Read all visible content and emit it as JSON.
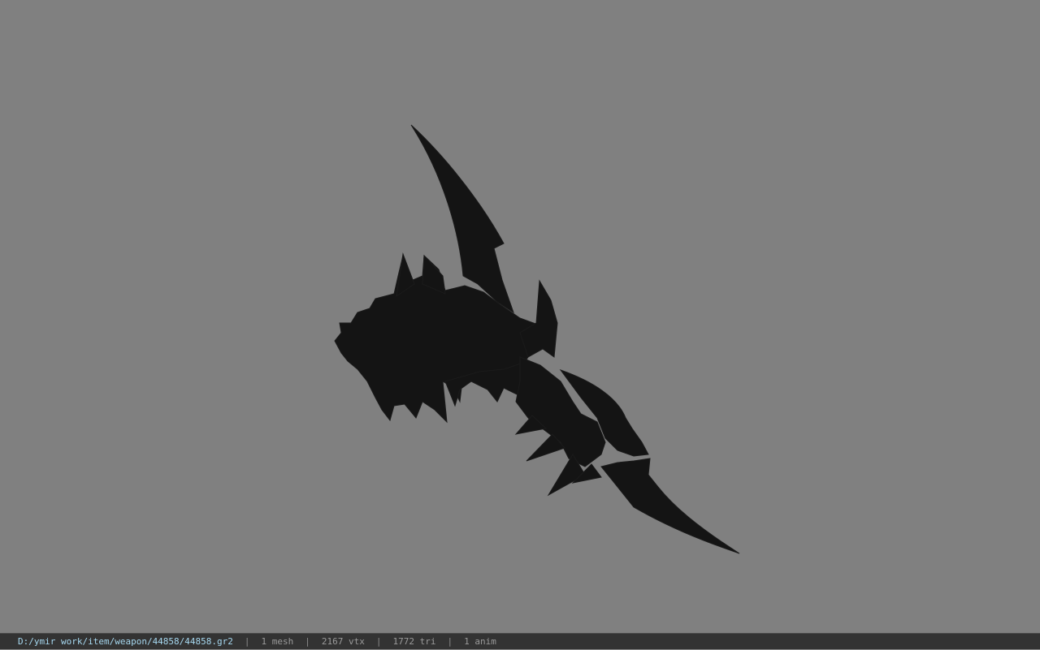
{
  "viewer": {
    "background_color": "#808080",
    "model_color": "#141414",
    "model_label": "weapon-model-silhouette"
  },
  "status_bar": {
    "file_path": "D:/ymir work/item/weapon/44858/44858.gr2",
    "separator": "|",
    "mesh": "1 mesh",
    "vertices": "2167 vtx",
    "triangles": "1772 tri",
    "animations": "1 anim"
  }
}
